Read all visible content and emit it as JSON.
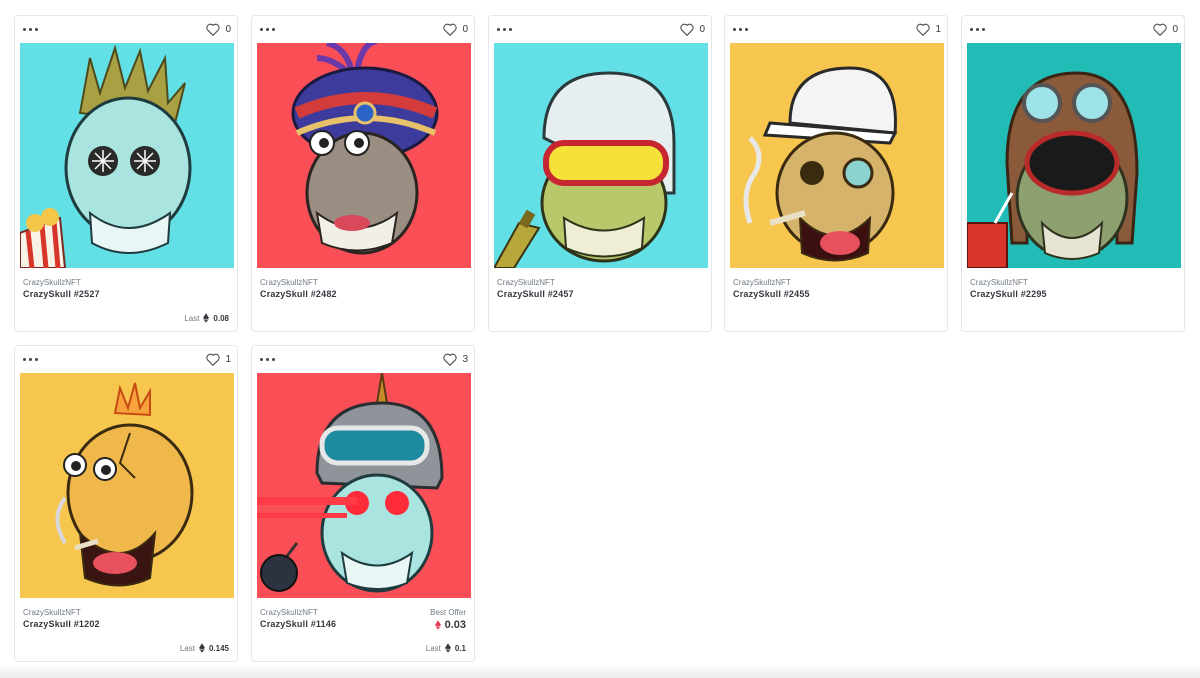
{
  "cards": [
    {
      "collection": "CrazySkullzNFT",
      "name": "CrazySkull #2527",
      "likes": "0",
      "last_label": "Last",
      "last_price": "0.08",
      "bg": "#62e0e6",
      "bone": "#a9e4e0"
    },
    {
      "collection": "CrazySkullzNFT",
      "name": "CrazySkull #2482",
      "likes": "0",
      "bg": "#fb4f58",
      "bone": "#9a8e82"
    },
    {
      "collection": "CrazySkullzNFT",
      "name": "CrazySkull #2457",
      "likes": "0",
      "bg": "#62e0e6",
      "bone": "#b8c86a"
    },
    {
      "collection": "CrazySkullzNFT",
      "name": "CrazySkull #2455",
      "likes": "1",
      "bg": "#f6c64f",
      "bone": "#d6b36a"
    },
    {
      "collection": "CrazySkullzNFT",
      "name": "CrazySkull #2295",
      "likes": "0",
      "bg": "#20bcb5",
      "bone": "#8fa070"
    },
    {
      "collection": "CrazySkullzNFT",
      "name": "CrazySkull #1202",
      "likes": "1",
      "last_label": "Last",
      "last_price": "0.145",
      "bg": "#f6c64f",
      "bone": "#f0b84a"
    },
    {
      "collection": "CrazySkullzNFT",
      "name": "CrazySkull #1146",
      "likes": "3",
      "best_offer_label": "Best Offer",
      "best_offer_price": "0.03",
      "last_label": "Last",
      "last_price": "0.1",
      "bg": "#fb4f58",
      "bone": "#a9e4e0"
    }
  ],
  "icons": {
    "more": "more-dots-icon",
    "like": "heart-icon",
    "currency": "eth-icon"
  },
  "colors": {
    "text": "#353840",
    "muted": "#707a83",
    "border": "#e5e8eb",
    "offer_eth": "#e2364f"
  }
}
